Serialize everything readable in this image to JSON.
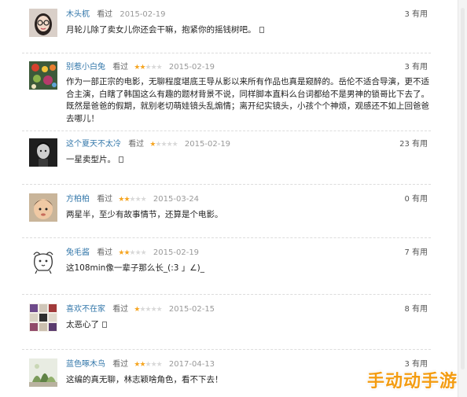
{
  "watermark": "手动动手游",
  "comments": [
    {
      "user": "木头杌",
      "rated": "看过",
      "stars": "",
      "date": "2015-02-19",
      "useful": "3 有用",
      "text": "月轮儿除了卖女儿你还会干嘛，抱紧你的摇钱树吧。",
      "avatar": "woman-with-glasses-avatar"
    },
    {
      "user": "别惹小白兔",
      "rated": "看过",
      "stars": "★★☆☆☆",
      "date": "2015-02-19",
      "useful": "3 有用",
      "text": "作为一部正宗的电影，无聊程度堪底王导从影以来所有作品也真是窥醉的。岳伦不适合导演，更不适合主演，白瞎了韩国这么有趣的题材背景不说，同样脚本直料么台词都给不是男神的锁哥比下去了。既然是爸爸的假期，就别老切萌娃镜头乱煽情；离开纪实镜头，小孩个个神烦，观感还不如上回爸爸去哪儿！",
      "avatar": "colorful-objects-avatar"
    },
    {
      "user": "这个夏天不太冷",
      "rated": "看过",
      "stars": "★☆☆☆☆",
      "date": "2015-02-19",
      "useful": "23 有用",
      "text": "一星卖型片。",
      "avatar": "dark-portrait-avatar"
    },
    {
      "user": "方柏柏",
      "rated": "看过",
      "stars": "★★☆☆☆",
      "date": "2015-03-24",
      "useful": "0 有用",
      "text": "两星半，至少有故事情节，还算是个电影。",
      "avatar": "child-face-avatar"
    },
    {
      "user": "兔毛酱",
      "rated": "看过",
      "stars": "★★☆☆☆",
      "date": "2015-02-19",
      "useful": "7 有用",
      "text": "这108min像一辈子那么长_(:3 」∠)_",
      "avatar": "doodle-dog-avatar"
    },
    {
      "user": "喜欢不在家",
      "rated": "看过",
      "stars": "★☆☆☆☆",
      "date": "2015-02-15",
      "useful": "8 有用",
      "text": "太恶心了",
      "avatar": "patterned-grid-avatar"
    },
    {
      "user": "蓝色啄木鸟",
      "rated": "看过",
      "stars": "★★☆☆☆",
      "date": "2017-04-13",
      "useful": "3 有用",
      "text": "这编的真无聊，林志颖啥角色，看不下去！",
      "avatar": "green-plants-avatar"
    }
  ]
}
